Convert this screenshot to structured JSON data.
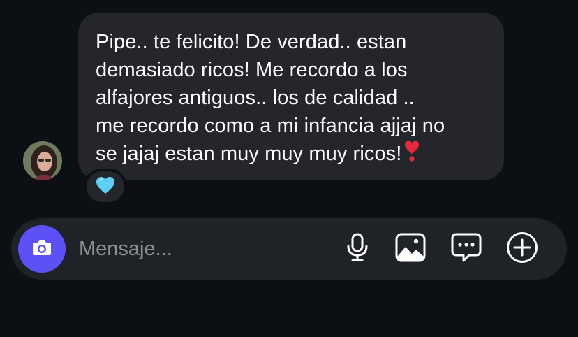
{
  "message": {
    "lines": [
      "Pipe.. te felicito! De verdad.. estan",
      "demasiado ricos! Me recordo a los",
      "alfajores antiguos.. los de calidad ..",
      "me recordo como a mi infancia ajjaj no",
      "se jajaj estan muy muy muy ricos!"
    ],
    "trailing_emoji": "heart-exclamation-icon",
    "reaction": "light-blue-heart-icon"
  },
  "composer": {
    "placeholder": "Mensaje...",
    "camera_icon": "camera-icon",
    "actions": [
      "microphone-icon",
      "gallery-icon",
      "sticker-chat-icon",
      "plus-circle-icon"
    ]
  },
  "colors": {
    "background": "#0c0f14",
    "bubble": "#24262c",
    "composer": "#1f2227",
    "camera_button": "#5b51f7",
    "placeholder_text": "#8e9096",
    "heart_red": "#e8283c",
    "heart_blue": "#5ccff5"
  }
}
